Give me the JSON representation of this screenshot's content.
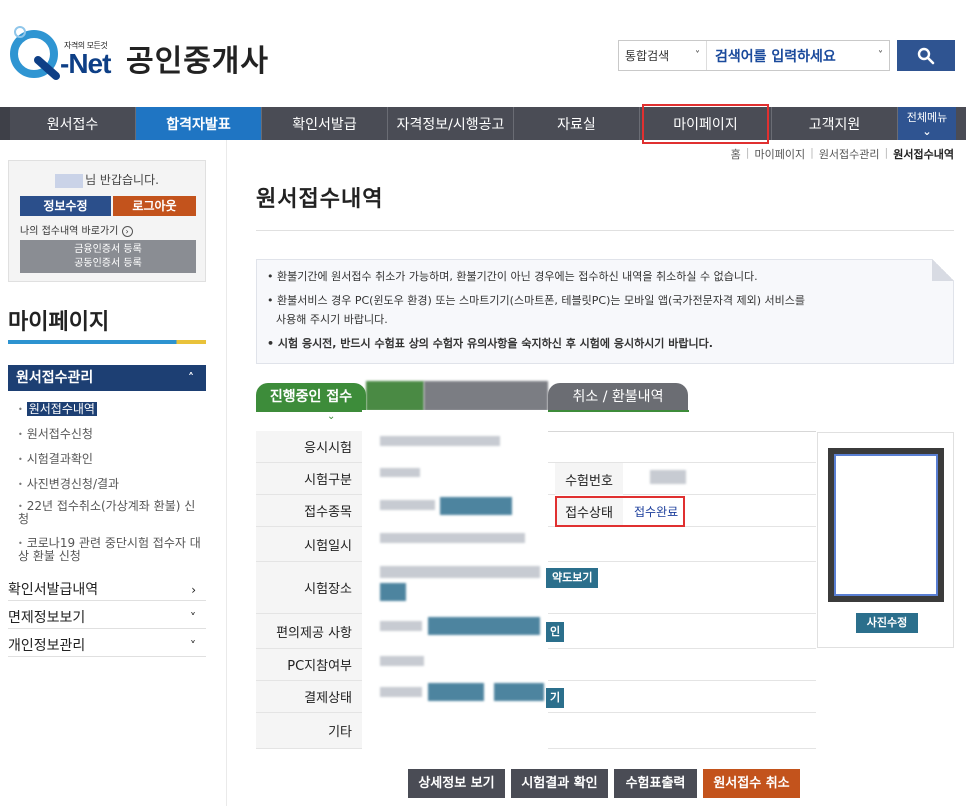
{
  "header": {
    "logo_small": "자격의 모든것",
    "logo_brand": "-Net",
    "site_title": "공인중개사",
    "search": {
      "scope": "통합검색",
      "placeholder": "검색어를 입력하세요"
    }
  },
  "nav": {
    "items": [
      "원서접수",
      "합격자발표",
      "확인서발급",
      "자격정보/시행공고",
      "자료실",
      "마이페이지",
      "고객지원"
    ],
    "all_menu": "전체메뉴"
  },
  "breadcrumb": [
    "홈",
    "마이페이지",
    "원서접수관리",
    "원서접수내역"
  ],
  "sidebar": {
    "greeting": "님 반갑습니다.",
    "edit_info": "정보수정",
    "logout": "로그아웃",
    "my_apply_link": "나의 접수내역 바로가기",
    "cert_line1": "금융인증서 등록",
    "cert_line2": "공동인증서 등록",
    "title": "마이페이지",
    "section": "원서접수관리",
    "sub_items": [
      "원서접수내역",
      "원서접수신청",
      "시험결과확인",
      "사진변경신청/결과",
      "22년 접수취소(가상계좌 환불) 신청",
      "코로나19 관련 중단시험 접수자 대상 환불 신청"
    ],
    "menus": [
      "확인서발급내역",
      "면제정보보기",
      "개인정보관리"
    ]
  },
  "main": {
    "title": "원서접수내역",
    "notices": [
      "환불기간에 원서접수 취소가 가능하며, 환불기간이 아닌 경우에는 접수하신 내역을 취소하실 수 없습니다.",
      "환불서비스 경우 PC(윈도우 환경) 또는 스마트기기(스마트폰, 테블릿PC)는 모바일 앱(국가전문자격 제외) 서비스를",
      "사용해 주시기 바랍니다.",
      "시험 응시전, 반드시 수험표 상의 수험자 유의사항을 숙지하신 후 시험에 응시하시기 바랍니다."
    ],
    "tabs": {
      "active": "진행중인 접수",
      "inactive": "취소 / 환불내역"
    },
    "rows": [
      "응시시험",
      "시험구분",
      "접수종목",
      "시험일시",
      "시험장소",
      "편의제공 사항",
      "PC지참여부",
      "결제상태",
      "기타"
    ],
    "exam_no_label": "수험번호",
    "status_label": "접수상태",
    "status_value": "접수완료",
    "map_btn": "약도보기",
    "convenience_btn": "인",
    "payment_btn": "기",
    "photo_btn": "사진수정"
  },
  "actions": [
    "상세정보 보기",
    "시험결과 확인",
    "수험표출력",
    "원서접수 취소"
  ],
  "colors": {
    "nav_bg": "#4a4c55",
    "nav_active": "#1f75c3",
    "navy": "#1d3f73",
    "tab_green": "#3d8c3a",
    "highlight_red": "#e03030",
    "cancel_orange": "#c3531c"
  }
}
